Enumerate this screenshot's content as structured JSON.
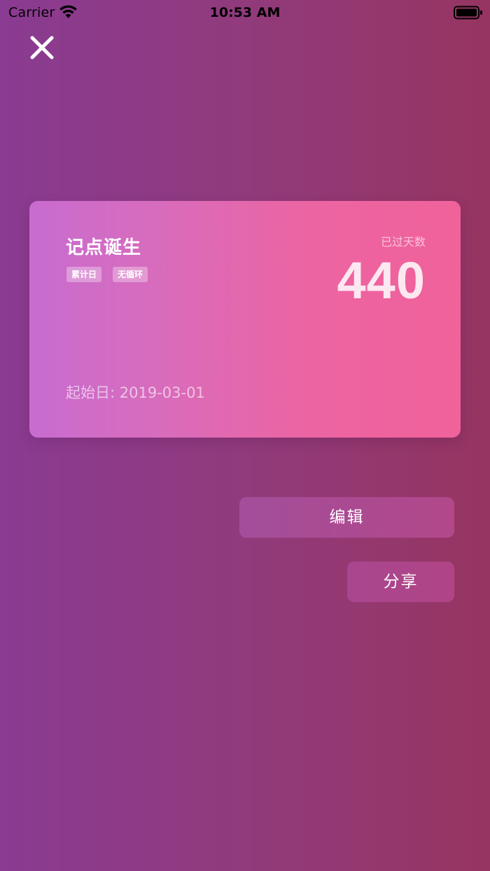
{
  "status_bar": {
    "carrier": "Carrier",
    "time": "10:53 AM",
    "wifi_icon": "wifi-icon",
    "battery_icon": "battery-icon"
  },
  "close_icon": "close-icon",
  "card": {
    "title": "记点诞生",
    "tags": [
      "累计日",
      "无循环"
    ],
    "counter_label": "已过天数",
    "counter_value": "440",
    "start_date": "起始日: 2019-03-01"
  },
  "actions": {
    "edit_label": "编辑",
    "share_label": "分享"
  },
  "colors": {
    "background_left": "#8a3b92",
    "background_right": "#963561",
    "card_left": "#c86cd0",
    "card_right": "#f0629a"
  }
}
